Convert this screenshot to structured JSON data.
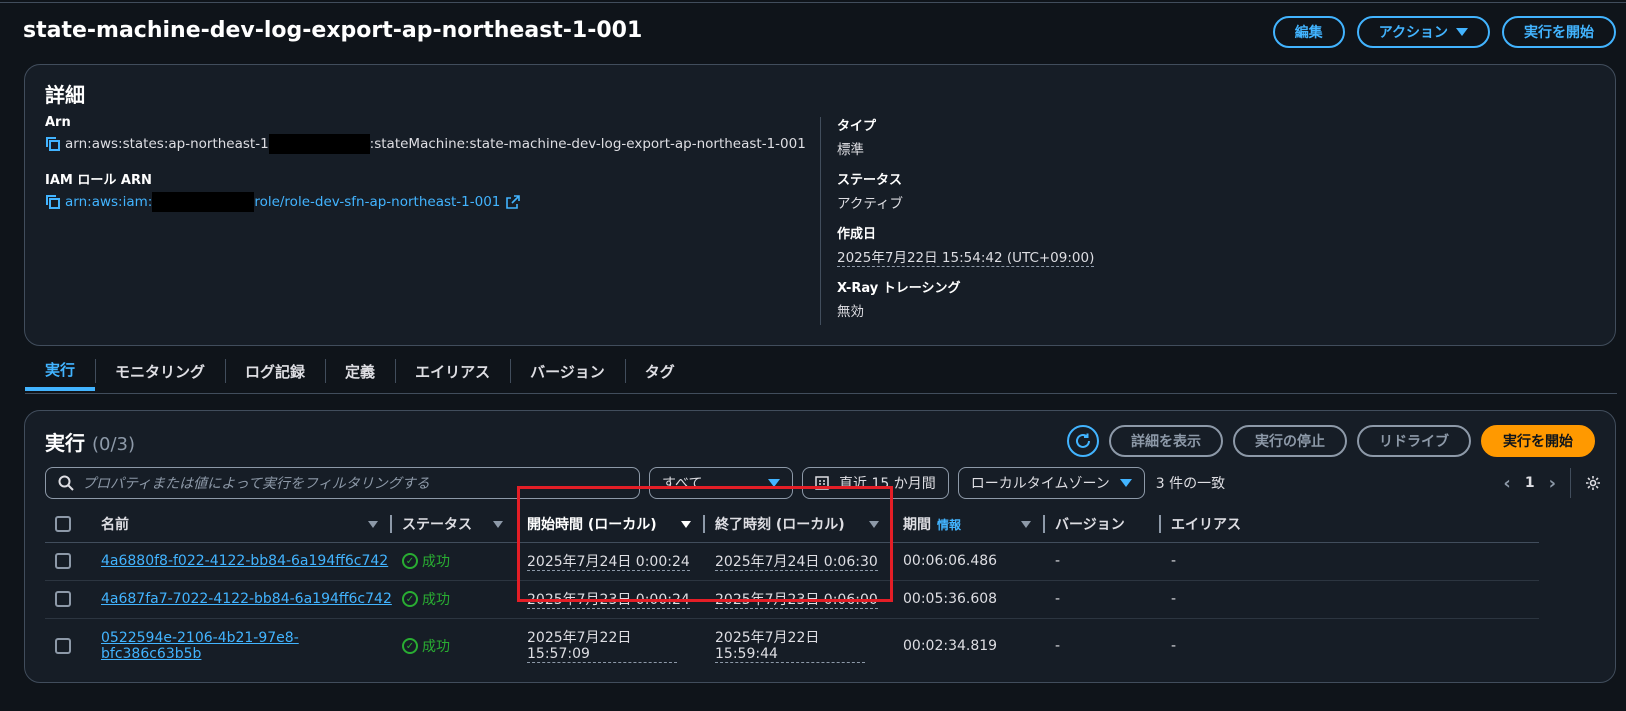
{
  "header": {
    "title": "state-machine-dev-log-export-ap-northeast-1-001",
    "buttons": {
      "edit": "編集",
      "actions": "アクション",
      "start": "実行を開始"
    }
  },
  "details": {
    "heading": "詳細",
    "arn_label": "Arn",
    "arn_prefix": "arn:aws:states:ap-northeast-1",
    "arn_suffix": ":stateMachine:state-machine-dev-log-export-ap-northeast-1-001",
    "iam_label": "IAM ロール ARN",
    "iam_prefix": "arn:aws:iam:",
    "iam_suffix": "role/role-dev-sfn-ap-northeast-1-001",
    "type_label": "タイプ",
    "type_value": "標準",
    "status_label": "ステータス",
    "status_value": "アクティブ",
    "created_label": "作成日",
    "created_value": "2025年7月22日 15:54:42 (UTC+09:00)",
    "xray_label": "X-Ray トレーシング",
    "xray_value": "無効"
  },
  "tabs": [
    "実行",
    "モニタリング",
    "ログ記録",
    "定義",
    "エイリアス",
    "バージョン",
    "タグ"
  ],
  "executions": {
    "heading": "実行",
    "count": "(0/3)",
    "buttons": {
      "details": "詳細を表示",
      "stop": "実行の停止",
      "redrive": "リドライブ",
      "start": "実行を開始"
    },
    "search_placeholder": "プロパティまたは値によって実行をフィルタリングする",
    "filter_status": "すべて",
    "filter_range": "直近 15 か月間",
    "filter_tz": "ローカルタイムゾーン",
    "match_count": "3 件の一致",
    "page": "1",
    "columns": {
      "name": "名前",
      "status": "ステータス",
      "start": "開始時間 (ローカル)",
      "end": "終了時刻 (ローカル)",
      "duration": "期間",
      "duration_info": "情報",
      "version": "バージョン",
      "alias": "エイリアス"
    },
    "rows": [
      {
        "name": "4a6880f8-f022-4122-bb84-6a194ff6c742",
        "status": "成功",
        "start": "2025年7月24日 0:00:24",
        "end": "2025年7月24日 0:06:30",
        "duration": "00:06:06.486",
        "version": "-",
        "alias": "-"
      },
      {
        "name": "4a687fa7-7022-4122-bb84-6a194ff6c742",
        "status": "成功",
        "start": "2025年7月23日 0:00:24",
        "end": "2025年7月23日 0:06:00",
        "duration": "00:05:36.608",
        "version": "-",
        "alias": "-"
      },
      {
        "name": "0522594e-2106-4b21-97e8-bfc386c63b5b",
        "status": "成功",
        "start_line1": "2025年7月22日",
        "start_line2": "15:57:09",
        "end_line1": "2025年7月22日",
        "end_line2": "15:59:44",
        "duration": "00:02:34.819",
        "version": "-",
        "alias": "-"
      }
    ]
  },
  "colors": {
    "accent": "#42b4ff",
    "primary": "#ff9900",
    "success": "#29ad32",
    "highlight": "#e41e26"
  }
}
